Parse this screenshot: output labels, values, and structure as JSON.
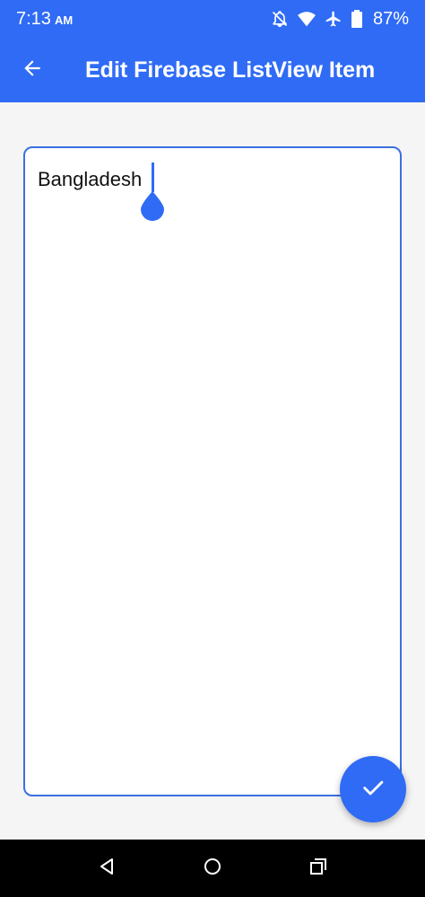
{
  "status_bar": {
    "time": "7:13",
    "ampm": "AM",
    "battery": "87%",
    "icons": [
      "notifications-off-icon",
      "wifi-icon",
      "airplane-icon",
      "battery-icon"
    ]
  },
  "app_bar": {
    "title": "Edit Firebase ListView Item",
    "back_icon": "arrow-back-icon"
  },
  "editor": {
    "value": "Bangladesh"
  },
  "fab": {
    "icon": "check-icon"
  },
  "nav_bar": {
    "icons": [
      "back-triangle-icon",
      "home-circle-icon",
      "recents-square-icon"
    ]
  },
  "colors": {
    "primary": "#2f6bf5",
    "border": "#3b6fe0",
    "background": "#f5f5f5"
  }
}
